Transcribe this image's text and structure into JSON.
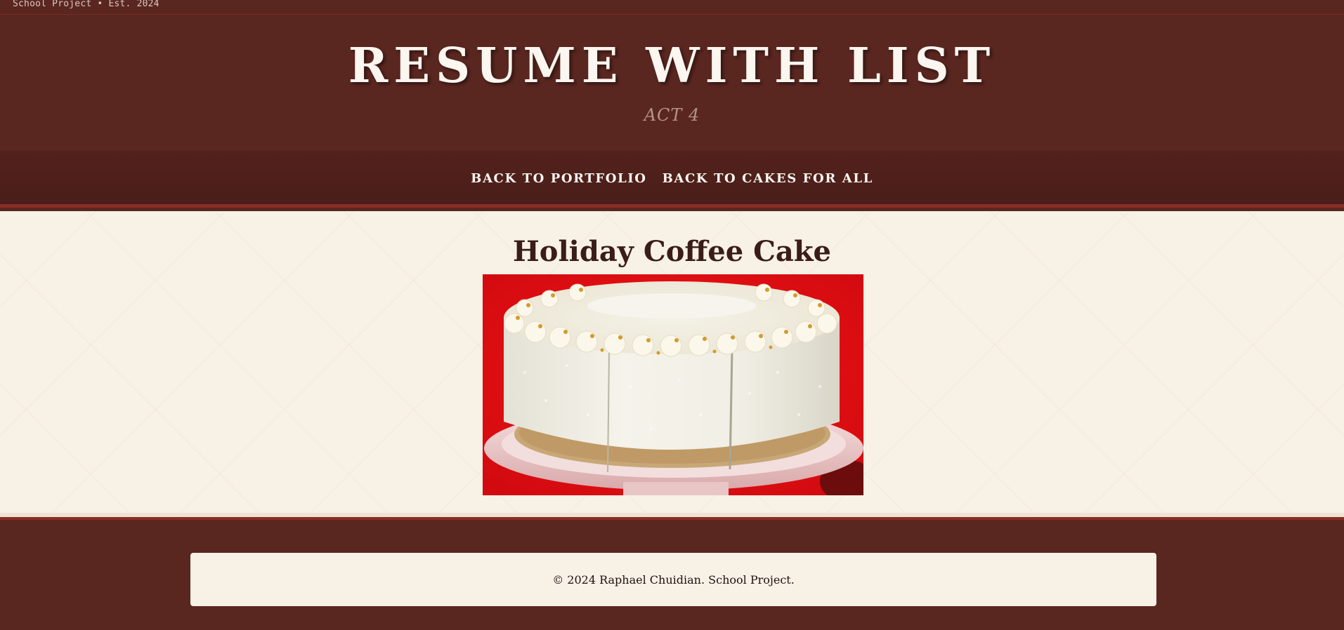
{
  "top_strip": {
    "text": "School Project • Est. 2024"
  },
  "header": {
    "title": "RESUME WITH LIST",
    "subtitle": "ACT 4"
  },
  "nav": {
    "links": [
      {
        "label": "BACK TO PORTFOLIO"
      },
      {
        "label": "BACK TO CAKES FOR ALL"
      }
    ]
  },
  "main": {
    "cake_title": "Holiday Coffee Cake",
    "image": {
      "subject": "white frosted layer cake on red background"
    }
  },
  "footer": {
    "copyright": "© 2024 Raphael Chuidian. School Project."
  },
  "colors": {
    "header_bg": "#5a2620",
    "accent_border": "#8c2d26",
    "content_bg": "#f8f1e6",
    "heading_text": "#3a1c18"
  }
}
